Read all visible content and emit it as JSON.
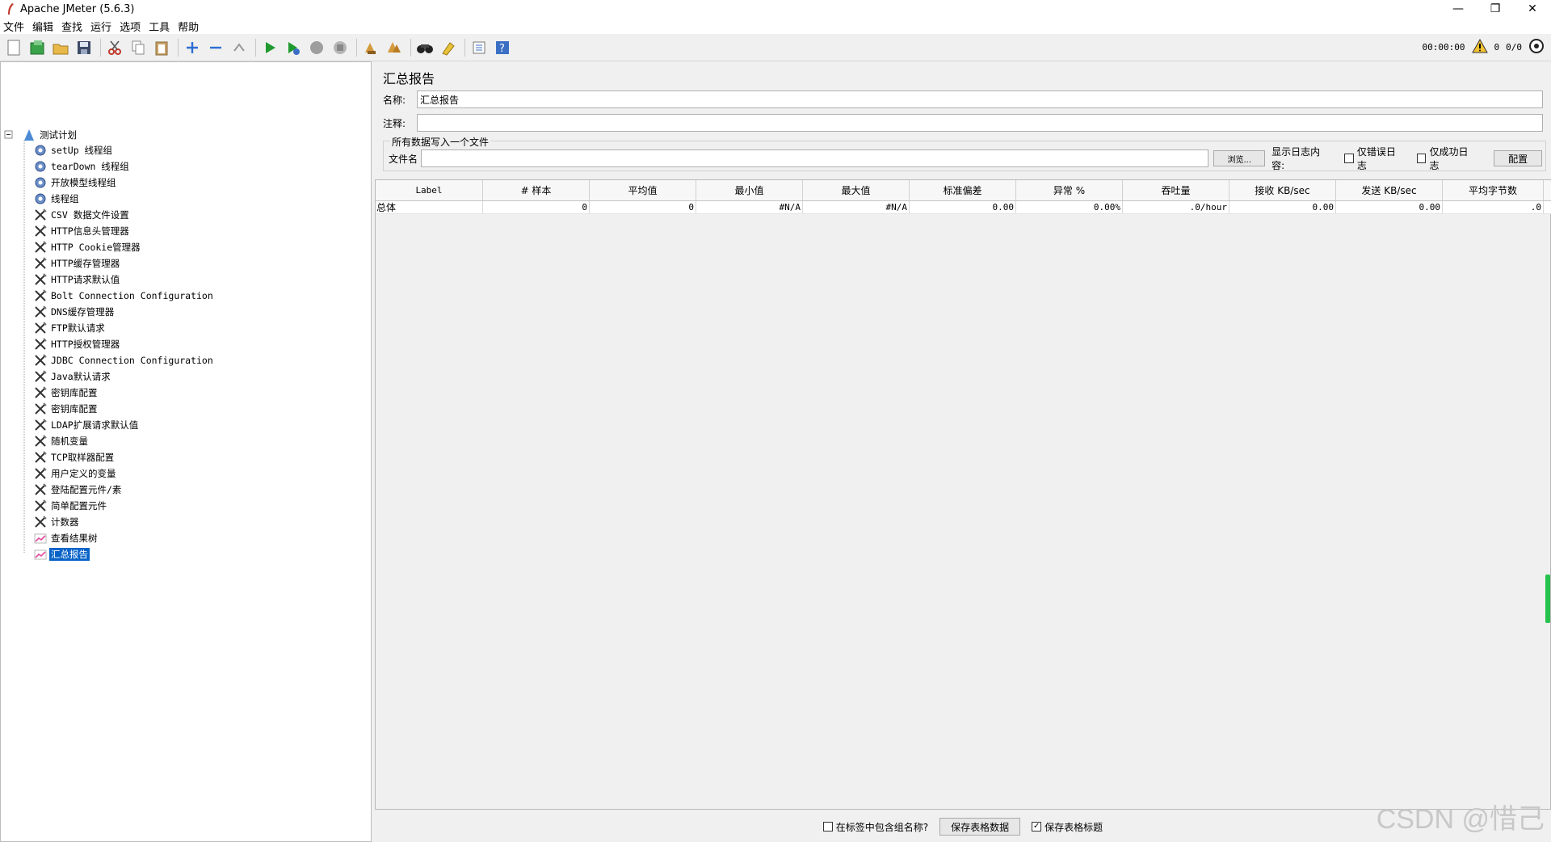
{
  "window": {
    "title": "Apache JMeter (5.6.3)",
    "controls": [
      "—",
      "❐",
      "✕"
    ]
  },
  "menu": [
    "文件",
    "编辑",
    "查找",
    "运行",
    "选项",
    "工具",
    "帮助"
  ],
  "toolbar": {
    "timer": "00:00:00",
    "warnings": "0",
    "threads": "0/0"
  },
  "tree": {
    "root": "测试计划",
    "items": [
      {
        "label": "setUp 线程组",
        "icon": "gear-icon"
      },
      {
        "label": "tearDown 线程组",
        "icon": "gear-icon"
      },
      {
        "label": "开放模型线程组",
        "icon": "gear-icon"
      },
      {
        "label": "线程组",
        "icon": "gear-icon"
      },
      {
        "label": "CSV 数据文件设置",
        "icon": "wrench-icon"
      },
      {
        "label": "HTTP信息头管理器",
        "icon": "wrench-icon"
      },
      {
        "label": "HTTP Cookie管理器",
        "icon": "wrench-icon"
      },
      {
        "label": "HTTP缓存管理器",
        "icon": "wrench-icon"
      },
      {
        "label": "HTTP请求默认值",
        "icon": "wrench-icon"
      },
      {
        "label": "Bolt Connection Configuration",
        "icon": "wrench-icon"
      },
      {
        "label": "DNS缓存管理器",
        "icon": "wrench-icon"
      },
      {
        "label": "FTP默认请求",
        "icon": "wrench-icon"
      },
      {
        "label": "HTTP授权管理器",
        "icon": "wrench-icon"
      },
      {
        "label": "JDBC Connection Configuration",
        "icon": "wrench-icon"
      },
      {
        "label": "Java默认请求",
        "icon": "wrench-icon"
      },
      {
        "label": "密钥库配置",
        "icon": "wrench-icon"
      },
      {
        "label": "密钥库配置",
        "icon": "wrench-icon"
      },
      {
        "label": "LDAP扩展请求默认值",
        "icon": "wrench-icon"
      },
      {
        "label": "随机变量",
        "icon": "wrench-icon"
      },
      {
        "label": "TCP取样器配置",
        "icon": "wrench-icon"
      },
      {
        "label": "用户定义的变量",
        "icon": "wrench-icon"
      },
      {
        "label": "登陆配置元件/素",
        "icon": "wrench-icon"
      },
      {
        "label": "简单配置元件",
        "icon": "wrench-icon"
      },
      {
        "label": "计数器",
        "icon": "wrench-icon"
      },
      {
        "label": "查看结果树",
        "icon": "chart-icon"
      },
      {
        "label": "汇总报告",
        "icon": "chart-icon",
        "selected": true
      }
    ]
  },
  "panel": {
    "title": "汇总报告",
    "name_label": "名称:",
    "name_value": "汇总报告",
    "comment_label": "注释:",
    "comment_value": "",
    "group_title": "所有数据写入一个文件",
    "file_label": "文件名",
    "file_value": "",
    "browse_label": "浏览...",
    "log_label": "显示日志内容:",
    "errors_only": "仅错误日志",
    "success_only": "仅成功日志",
    "config_button": "配置"
  },
  "table": {
    "headers": [
      "Label",
      "# 样本",
      "平均值",
      "最小值",
      "最大值",
      "标准偏差",
      "异常 %",
      "吞吐量",
      "接收 KB/sec",
      "发送 KB/sec",
      "平均字节数"
    ],
    "rows": [
      [
        "总体",
        "0",
        "0",
        "#N/A",
        "#N/A",
        "0.00",
        "0.00%",
        ".0/hour",
        "0.00",
        "0.00",
        ".0"
      ]
    ]
  },
  "bottom": {
    "include_group": "在标签中包含组名称?",
    "save_table": "保存表格数据",
    "save_headers": "保存表格标题"
  },
  "watermark": "CSDN @惜己"
}
